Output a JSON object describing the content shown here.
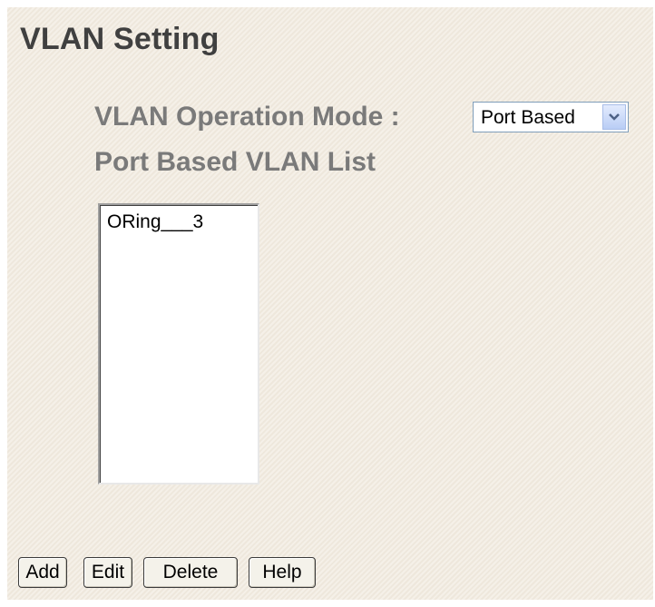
{
  "page": {
    "title": "VLAN Setting"
  },
  "operation_mode": {
    "label": "VLAN Operation Mode :",
    "selected": "Port Based",
    "arrow_icon": "chevron-down-icon"
  },
  "vlan_list": {
    "label": "Port Based VLAN List",
    "items": [
      "ORing___3"
    ]
  },
  "buttons": {
    "add": "Add",
    "edit": "Edit",
    "delete": "Delete",
    "help": "Help"
  },
  "colors": {
    "background": "#f2ebe0",
    "title": "#404040",
    "label": "#7a7a7a",
    "select_border": "#7f9db9"
  }
}
